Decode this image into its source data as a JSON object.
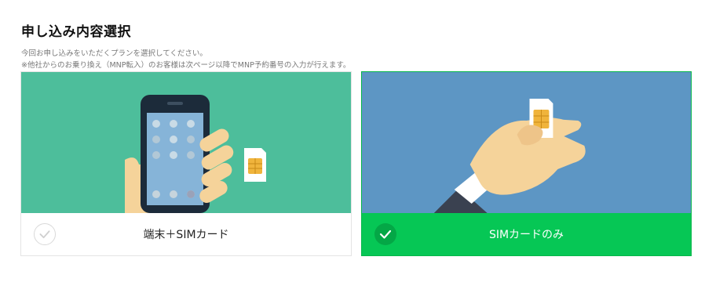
{
  "section": {
    "title": "申し込み内容選択",
    "description_line1": "今回お申し込みをいただくプランを選択してください。",
    "description_line2": "※他社からのお乗り換え（MNP転入）のお客様は次ページ以降でMNP予約番号の入力が行えます。"
  },
  "plans": [
    {
      "label": "端末＋SIMカード",
      "selected": false,
      "illustration": "phone-and-sim-illustration",
      "bg_color": "#4dbe9b"
    },
    {
      "label": "SIMカードのみ",
      "selected": true,
      "illustration": "sim-card-in-hand-illustration",
      "bg_color": "#5d96c4"
    }
  ],
  "colors": {
    "selected": "#06c755",
    "selected_check": "#04a746",
    "unselected_border": "#e4e4e4"
  },
  "icons": {
    "check": "check-icon"
  }
}
